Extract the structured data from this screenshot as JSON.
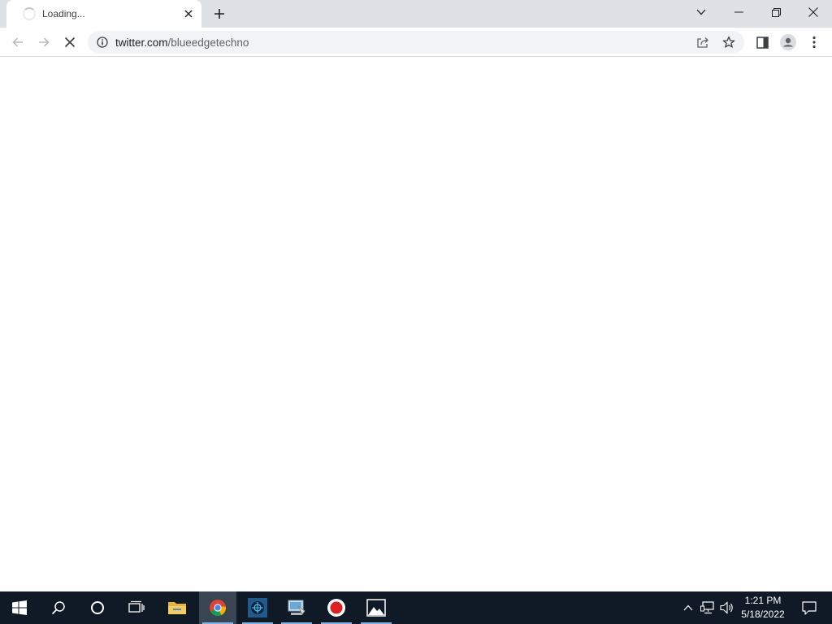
{
  "browser": {
    "tab": {
      "title": "Loading...",
      "close_icon": "close-icon"
    },
    "new_tab_icon": "plus-icon",
    "window_controls": [
      "tab-search-icon",
      "minimize-icon",
      "restore-icon",
      "close-icon"
    ],
    "toolbar": {
      "back_icon": "arrow-left-icon",
      "forward_icon": "arrow-right-icon",
      "stop_icon": "stop-loading-icon",
      "address": {
        "host": "twitter.com",
        "path": "/blueedgetechno"
      },
      "share_icon": "share-icon",
      "bookmark_icon": "star-icon",
      "side_panel_icon": "side-panel-icon",
      "profile_icon": "profile-icon",
      "menu_icon": "kebab-menu-icon"
    }
  },
  "taskbar": {
    "apps": [
      {
        "name": "start-icon"
      },
      {
        "name": "search-icon"
      },
      {
        "name": "cortana-icon"
      },
      {
        "name": "task-view-icon"
      },
      {
        "name": "file-explorer-icon"
      },
      {
        "name": "chrome-icon",
        "active": true
      },
      {
        "name": "app-icon",
        "running": true
      },
      {
        "name": "control-panel-icon",
        "running": true
      },
      {
        "name": "record-icon",
        "running": true
      },
      {
        "name": "photos-icon",
        "running": true
      }
    ],
    "tray": {
      "icons": [
        "chevron-up-icon",
        "network-icon",
        "volume-icon"
      ],
      "time": "1:21 PM",
      "date": "5/18/2022",
      "notification_icon": "notification-icon"
    }
  },
  "colors": {
    "tabstrip": "#dee1e6",
    "omnibox": "#f1f3f4",
    "taskbar": "#0f1a26",
    "taskbar_active": "#3a4553",
    "taskbar_indicator": "#7fb2e5"
  }
}
